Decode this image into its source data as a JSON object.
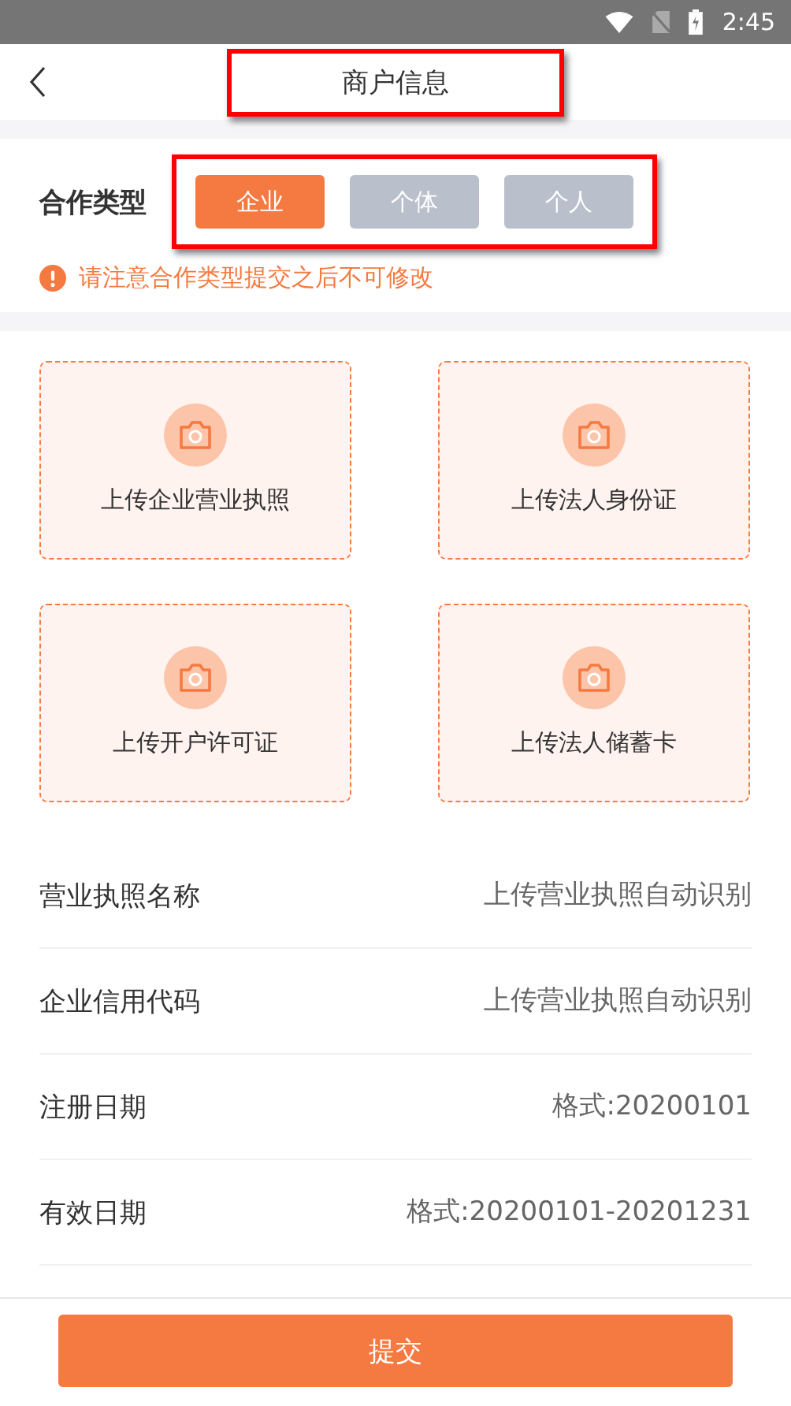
{
  "status_bar": {
    "time": "2:45"
  },
  "header": {
    "title": "商户信息",
    "highlighted": true
  },
  "cooperation": {
    "label": "合作类型",
    "highlighted": true,
    "options": [
      {
        "label": "企业",
        "selected": true
      },
      {
        "label": "个体",
        "selected": false
      },
      {
        "label": "个人",
        "selected": false
      }
    ],
    "warning": "请注意合作类型提交之后不可修改"
  },
  "uploads": [
    {
      "label": "上传企业营业执照"
    },
    {
      "label": "上传法人身份证"
    },
    {
      "label": "上传开户许可证"
    },
    {
      "label": "上传法人储蓄卡"
    }
  ],
  "fields": [
    {
      "label": "营业执照名称",
      "placeholder": "上传营业执照自动识别"
    },
    {
      "label": "企业信用代码",
      "placeholder": "上传营业执照自动识别"
    },
    {
      "label": "注册日期",
      "placeholder": "格式:20200101"
    },
    {
      "label": "有效日期",
      "placeholder": "格式:20200101-20201231"
    }
  ],
  "submit": "提交"
}
